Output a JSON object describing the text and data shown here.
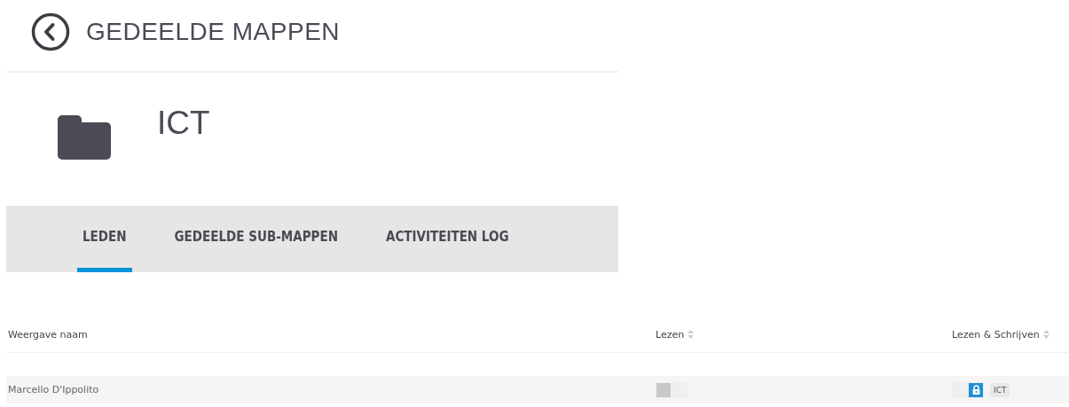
{
  "header": {
    "title": "GEDEELDE MAPPEN"
  },
  "folder": {
    "name": "ICT"
  },
  "tabs": [
    {
      "label": "LEDEN",
      "selected": true
    },
    {
      "label": "GEDEELDE SUB-MAPPEN",
      "selected": false
    },
    {
      "label": "ACTIVITEITEN LOG",
      "selected": false
    }
  ],
  "table": {
    "columns": [
      {
        "label": "Weergave naam",
        "sortable": false
      },
      {
        "label": "Lezen",
        "sortable": true
      },
      {
        "label": "Lezen & Schrijven",
        "sortable": true
      }
    ],
    "rows": [
      {
        "name": "Marcello D'Ippolito",
        "read": {
          "on": false
        },
        "write": {
          "on": true,
          "locked": true,
          "tag": "ICT"
        }
      }
    ]
  }
}
